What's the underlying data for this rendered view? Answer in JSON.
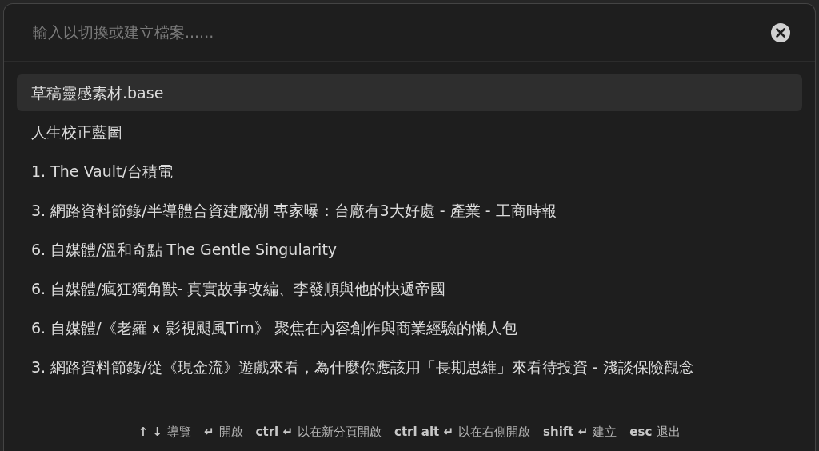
{
  "search": {
    "placeholder": "輸入以切換或建立檔案......"
  },
  "results": [
    {
      "label": "草稿靈感素材.base",
      "selected": true
    },
    {
      "label": "人生校正藍圖",
      "selected": false
    },
    {
      "label": "1. The Vault/台積電",
      "selected": false
    },
    {
      "label": "3. 網路資料節錄/半導體合資建廠潮 專家曝：台廠有3大好處 - 產業 - 工商時報",
      "selected": false
    },
    {
      "label": "6. 自媒體/溫和奇點 The Gentle Singularity",
      "selected": false
    },
    {
      "label": "6. 自媒體/瘋狂獨角獸- 真實故事改編、李發順與他的快遞帝國",
      "selected": false
    },
    {
      "label": "6. 自媒體/《老羅 x 影視颶風Tim》 聚焦在內容創作與商業經驗的懶人包",
      "selected": false
    },
    {
      "label": "3. 網路資料節錄/從《現金流》遊戲來看，為什麼你應該用「長期思維」來看待投資 - 淺談保險觀念",
      "selected": false
    }
  ],
  "hints": [
    {
      "keys": "↑ ↓",
      "label": "導覽"
    },
    {
      "keys": "↵",
      "label": "開啟"
    },
    {
      "keys": "ctrl ↵",
      "label": "以在新分頁開啟"
    },
    {
      "keys": "ctrl alt ↵",
      "label": "以在右側開啟"
    },
    {
      "keys": "shift ↵",
      "label": "建立"
    },
    {
      "keys": "esc",
      "label": "退出"
    }
  ]
}
